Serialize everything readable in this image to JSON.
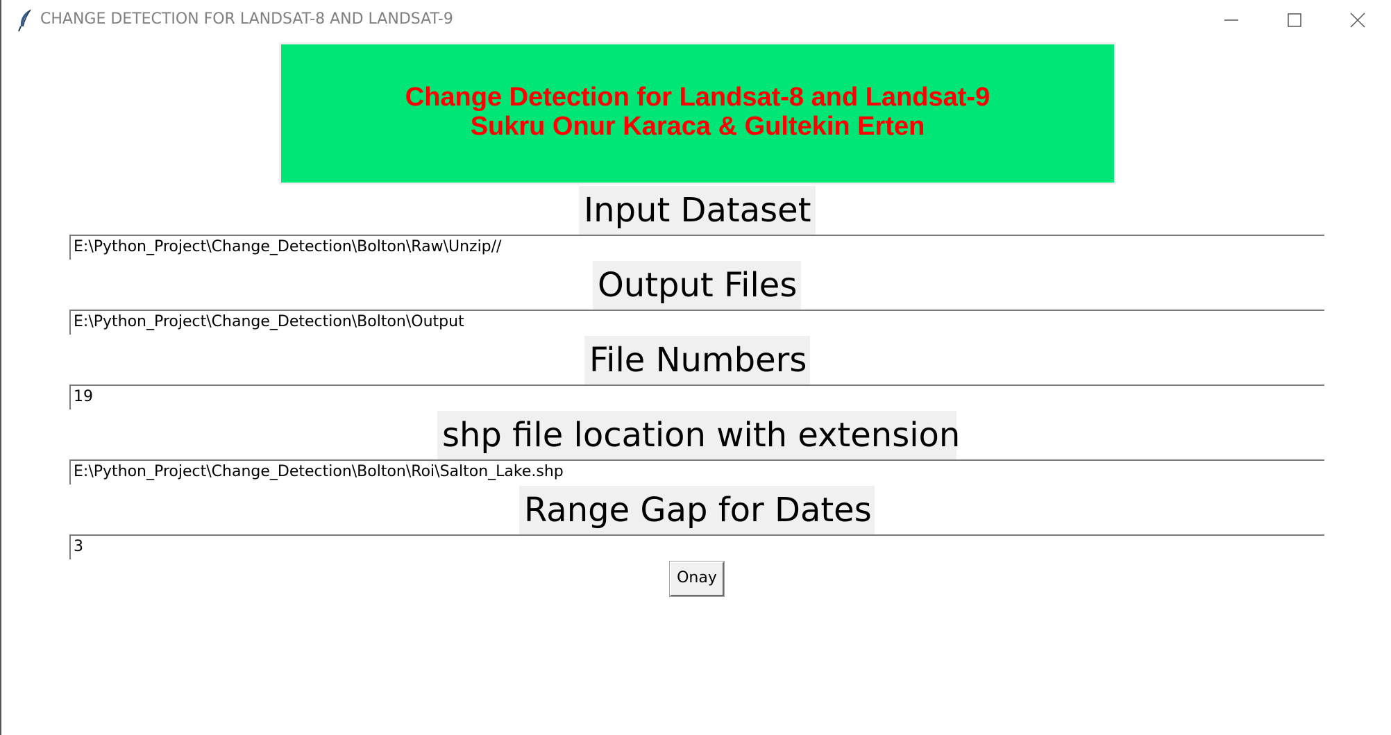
{
  "window": {
    "title": "CHANGE DETECTION FOR LANDSAT-8 AND LANDSAT-9"
  },
  "banner": {
    "line1": "Change Detection for Landsat-8 and Landsat-9",
    "line2": "Sukru Onur Karaca & Gultekin Erten",
    "background_color": "#00e676",
    "text_color": "#ff0000"
  },
  "fields": {
    "input_dataset": {
      "label": "Input Dataset",
      "value": "E:\\Python_Project\\Change_Detection\\Bolton\\Raw\\Unzip//"
    },
    "output_files": {
      "label": "Output Files",
      "value": "E:\\Python_Project\\Change_Detection\\Bolton\\Output"
    },
    "file_numbers": {
      "label": "File Numbers",
      "value": "19"
    },
    "shp_file": {
      "label": "shp file location with extension",
      "value": "E:\\Python_Project\\Change_Detection\\Bolton\\Roi\\Salton_Lake.shp"
    },
    "range_gap": {
      "label": "Range Gap for Dates",
      "value": "3"
    }
  },
  "confirm_button": {
    "label": "Onay"
  },
  "icons": {
    "app": "feather-icon",
    "minimize": "minimize-icon",
    "maximize": "maximize-icon",
    "close": "close-icon"
  }
}
